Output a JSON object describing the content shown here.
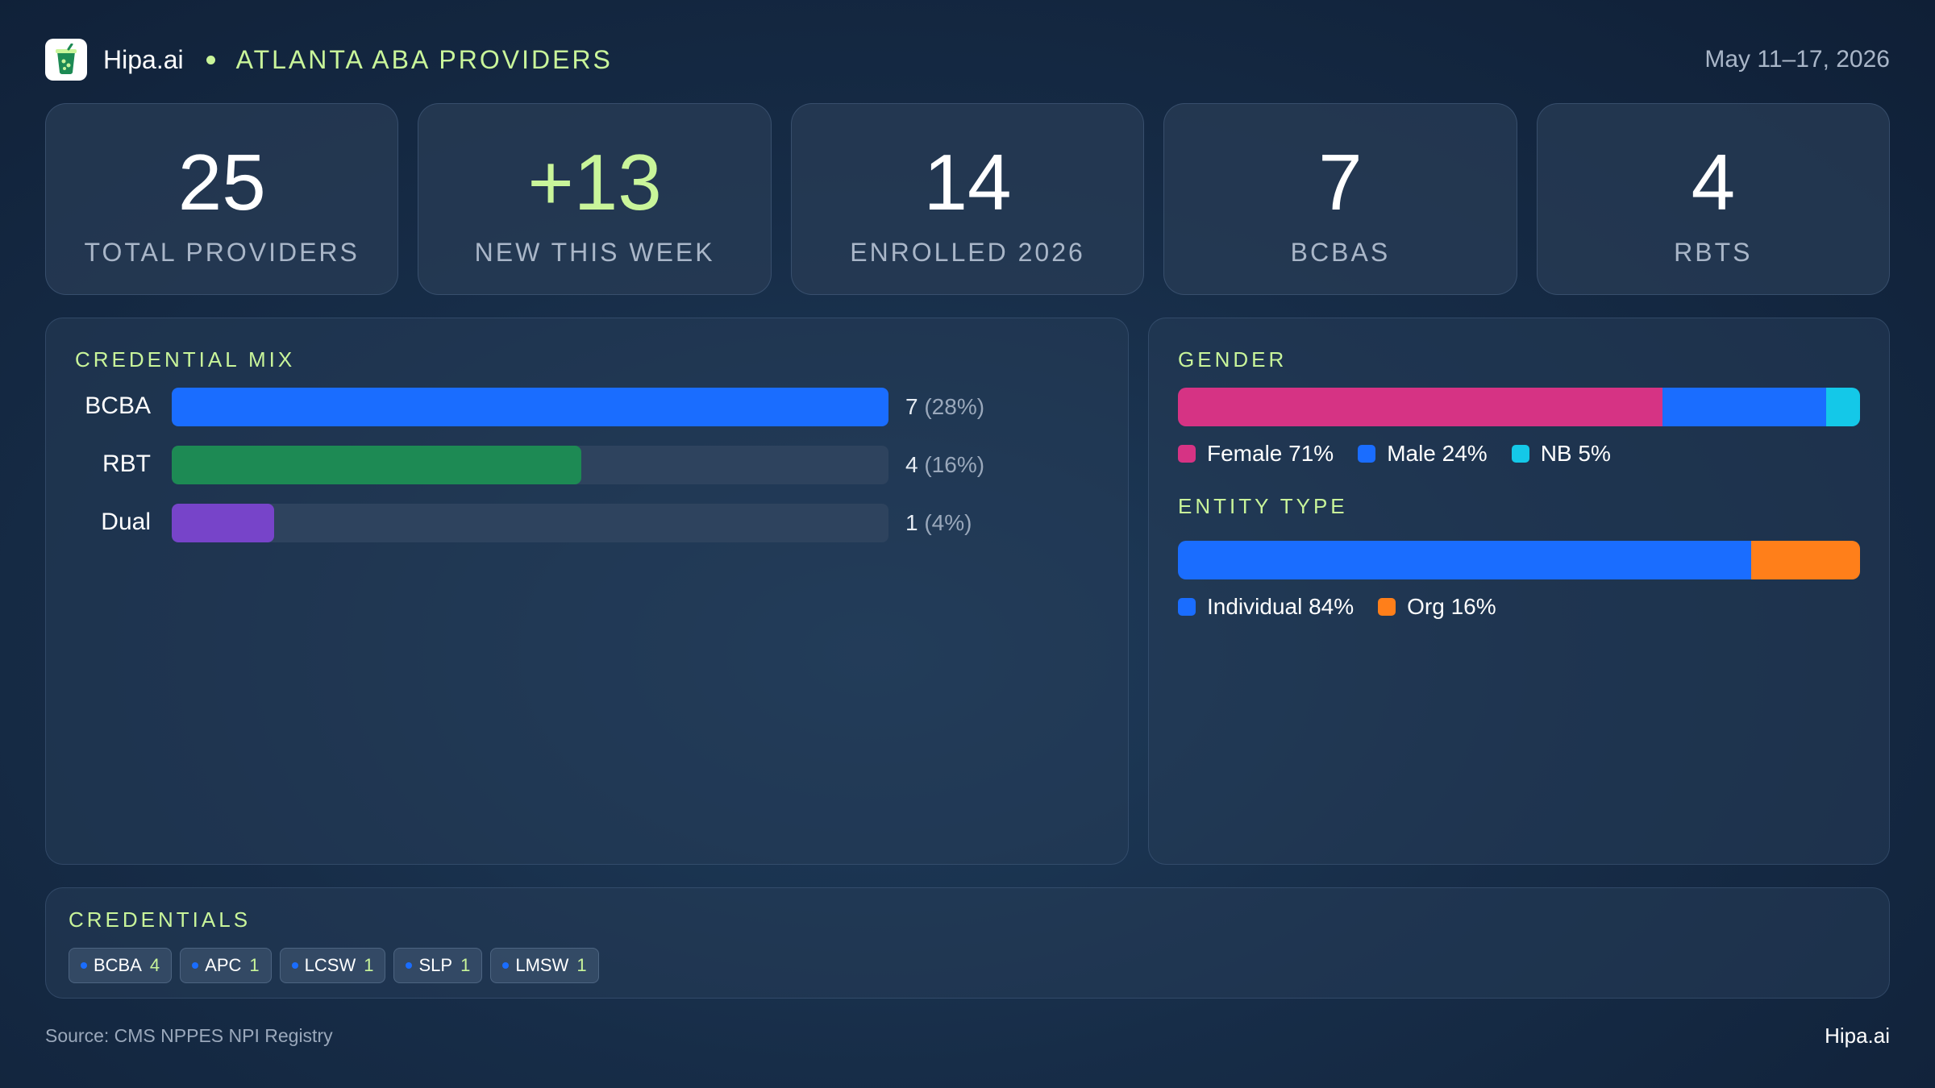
{
  "header": {
    "brand": "Hipa.ai",
    "region": "ATLANTA  ABA PROVIDERS",
    "date_range": "May 11–17, 2026",
    "logo_icon": "cup-icon"
  },
  "kpis": [
    {
      "value": "25",
      "label": "TOTAL  PROVIDERS"
    },
    {
      "value": "+13",
      "label": "NEW THIS WEEK"
    },
    {
      "value": "14",
      "label": "ENROLLED 2026"
    },
    {
      "value": "7",
      "label": "BCBAS"
    },
    {
      "value": "4",
      "label": "RBTS"
    }
  ],
  "credential_mix": {
    "title": "CREDENTIAL MIX",
    "rows": [
      {
        "label": "BCBA",
        "count": "7",
        "pct": "(28%)",
        "fill": 1.0,
        "color": "#1a6dff"
      },
      {
        "label": "RBT",
        "count": "4",
        "pct": "(16%)",
        "fill": 0.571,
        "color": "#1d8a54"
      },
      {
        "label": "Dual",
        "count": "1",
        "pct": "(4%)",
        "fill": 0.143,
        "color": "#7744c9"
      }
    ]
  },
  "gender": {
    "title": "GENDER",
    "segments": [
      {
        "label": "Female 71%",
        "share": 71,
        "color": "#d63384"
      },
      {
        "label": "Male 24%",
        "share": 24,
        "color": "#1a6dff"
      },
      {
        "label": "NB 5%",
        "share": 5,
        "color": "#14c8e8"
      }
    ]
  },
  "entity_type": {
    "title": "ENTITY TYPE",
    "segments": [
      {
        "label": "Individual 84%",
        "share": 84,
        "color": "#1a6dff"
      },
      {
        "label": "Org 16%",
        "share": 16,
        "color": "#ff7f1a"
      }
    ]
  },
  "credentials": {
    "title": "CREDENTIALS",
    "chips": [
      {
        "name": "BCBA",
        "count": "4"
      },
      {
        "name": "APC",
        "count": "1"
      },
      {
        "name": "LCSW",
        "count": "1"
      },
      {
        "name": "SLP",
        "count": "1"
      },
      {
        "name": "LMSW",
        "count": "1"
      }
    ]
  },
  "footer": {
    "source": "Source: CMS NPPES NPI Registry",
    "brand": "Hipa.ai"
  },
  "colors": {
    "accent": "#c9f59a",
    "background": "#172d48"
  }
}
